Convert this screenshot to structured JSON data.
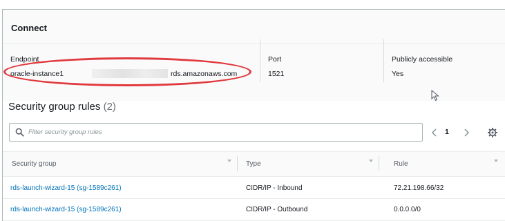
{
  "connect": {
    "title": "Connect",
    "endpoint": {
      "label": "Endpoint",
      "value_prefix": "oracle-instance1",
      "value_suffix": "rds.amazonaws.com"
    },
    "port": {
      "label": "Port",
      "value": "1521"
    },
    "publicly_accessible": {
      "label": "Publicly accessible",
      "value": "Yes"
    }
  },
  "security_group_rules": {
    "title": "Security group rules",
    "count": "(2)",
    "filter_placeholder": "Filter security group rules",
    "page": "1",
    "columns": [
      "Security group",
      "Type",
      "Rule"
    ],
    "rows": [
      {
        "security_group": "rds-launch-wizard-15 (sg-1589c261)",
        "type": "CIDR/IP - Inbound",
        "rule": "72.21.198.66/32"
      },
      {
        "security_group": "rds-launch-wizard-15 (sg-1589c261)",
        "type": "CIDR/IP - Outbound",
        "rule": "0.0.0.0/0"
      }
    ]
  },
  "icons": {
    "search": "search-icon",
    "prev": "chevron-left-icon",
    "next": "chevron-right-icon",
    "settings": "gear-icon",
    "sort": "sort-down-icon",
    "cursor": "mouse-pointer-icon"
  },
  "colors": {
    "link": "#0073bb",
    "highlight": "#e0393e",
    "text": "#16191f",
    "muted": "#687078"
  }
}
